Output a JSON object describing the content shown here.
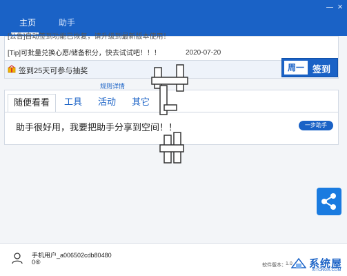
{
  "window": {
    "minimize_icon": "minimize-icon",
    "close_glyph": "×"
  },
  "nav": {
    "tabs": [
      {
        "label": "主页",
        "active": true
      },
      {
        "label": "助手",
        "active": false
      }
    ]
  },
  "notices": {
    "rows": [
      {
        "text": "[公告]自动签到功能已恢复，请升级到最新版本使用！"
      },
      {
        "text": "[Tip]可批量兑换心愿/储备积分，快去试试吧！！！"
      }
    ],
    "row2_date": "2020-07-20"
  },
  "checkin": {
    "message": "签到25天可参与抽奖",
    "weekday": "周一",
    "signin_label": "签到",
    "rules_link": "规则详情"
  },
  "content_tabs": {
    "tabs": [
      {
        "label": "随便看看",
        "active": true
      },
      {
        "label": "工具",
        "active": false
      },
      {
        "label": "活动",
        "active": false
      },
      {
        "label": "其它",
        "active": false
      }
    ],
    "message": "助手很好用，我要把助手分享到空间！！",
    "share_button": "一步助手"
  },
  "footer": {
    "username": "手机用户_a006502cdb80480",
    "points": "0⑥",
    "version_label": "软件版本：",
    "version_value": "1.0",
    "brand_name": "系统屋",
    "brand_domain": "XITONGS.COM"
  },
  "colors": {
    "header": "#1a62c6",
    "accent": "#1a62c6",
    "share_float": "#1a7be0",
    "background": "#f3f5f8"
  }
}
